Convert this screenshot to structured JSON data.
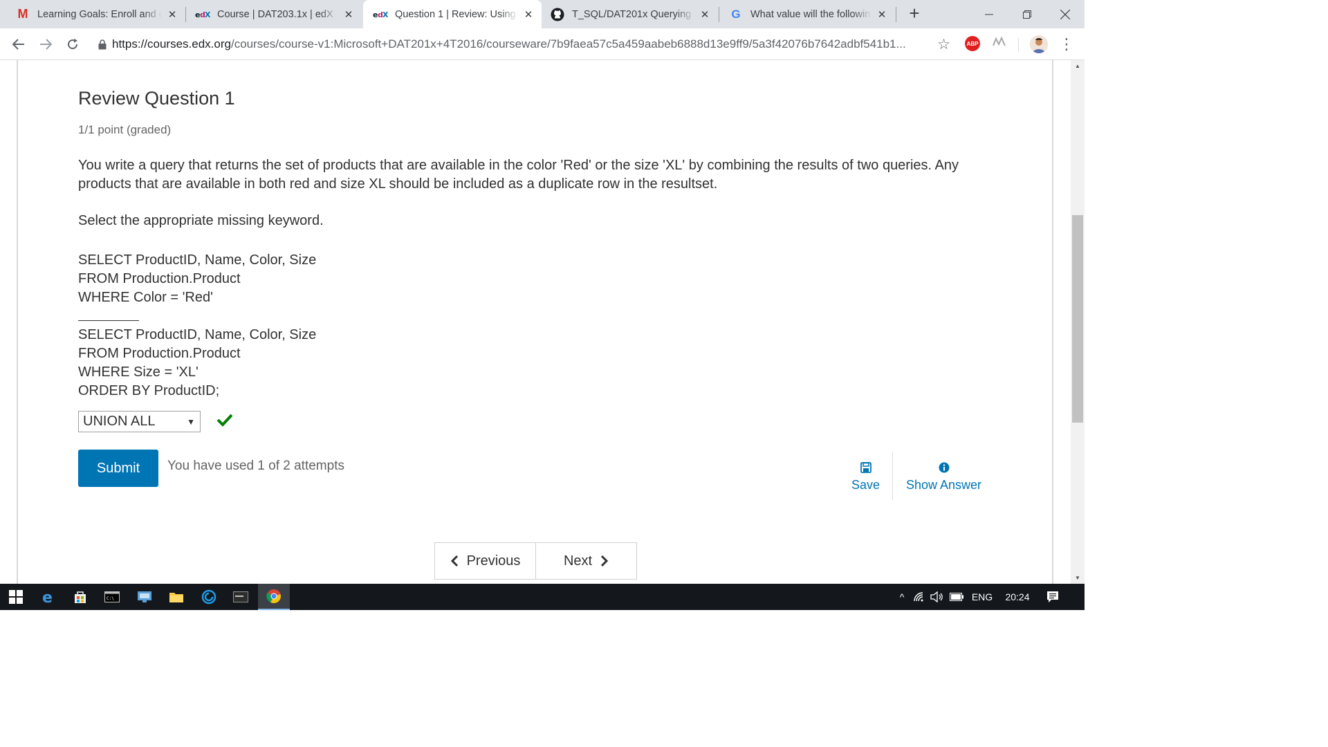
{
  "browser": {
    "tabs": [
      {
        "favicon": "gmail-icon",
        "title": "Learning Goals: Enroll and c"
      },
      {
        "favicon": "edx-icon",
        "title": "Course | DAT203.1x | edX"
      },
      {
        "favicon": "edx-icon",
        "title": "Question 1 | Review: Using S",
        "active": true
      },
      {
        "favicon": "github-icon",
        "title": "T_SQL/DAT201x Querying w"
      },
      {
        "favicon": "google-icon",
        "title": "What value will the followin"
      }
    ],
    "close_glyph": "✕",
    "newtab_glyph": "+",
    "address": {
      "host": "https://courses.edx.org",
      "path": "/courses/course-v1:Microsoft+DAT201x+4T2016/courseware/7b9faea57c5a459aabeb6888d13e9ff9/5a3f42076b7642adbf541b1..."
    },
    "extensions": {
      "abp": "ABP"
    }
  },
  "problem": {
    "title": "Review Question 1",
    "points": "1/1 point (graded)",
    "question": "You write a query that returns the set of products that are available in the color 'Red' or the size 'XL' by combining the results of two queries. Any products that are available in both red and size XL should be included as a duplicate row in the resultset.",
    "instruction": "Select the appropriate missing keyword.",
    "code_part1": [
      "SELECT ProductID, Name, Color, Size",
      "FROM Production.Product",
      "WHERE Color = 'Red'"
    ],
    "code_part2": [
      "SELECT ProductID, Name, Color, Size",
      "FROM Production.Product",
      "WHERE Size = 'XL'",
      "ORDER BY ProductID;"
    ],
    "selected_answer": "UNION ALL",
    "status": "correct",
    "submit_label": "Submit",
    "attempts_text": "You have used 1 of 2 attempts",
    "save_label": "Save",
    "show_answer_label": "Show Answer"
  },
  "sequence_nav": {
    "previous_label": "Previous",
    "next_label": "Next"
  },
  "taskbar": {
    "language": "ENG",
    "time": "20:24"
  },
  "colors": {
    "accent": "#0075b4",
    "success": "#008100"
  }
}
